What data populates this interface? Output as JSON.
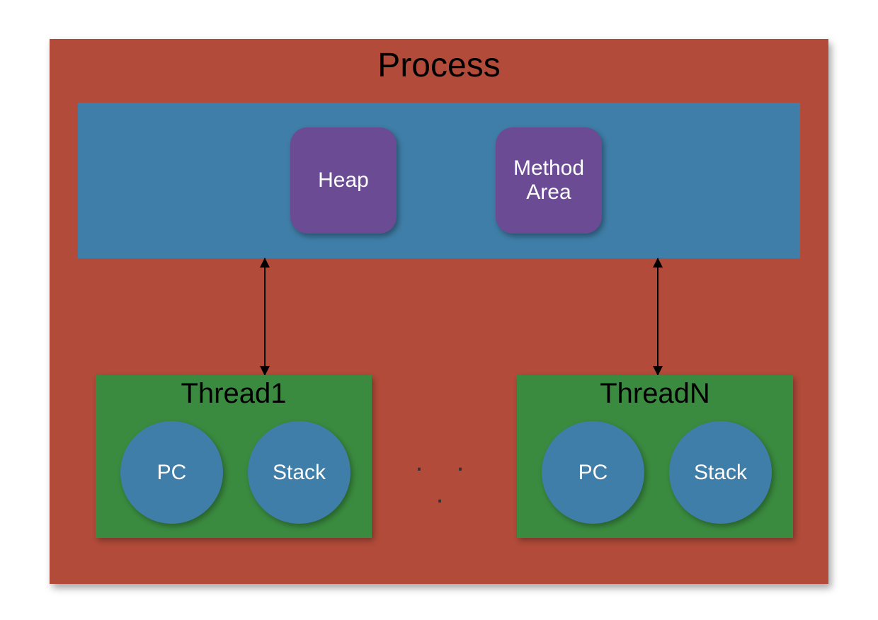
{
  "process": {
    "title": "Process",
    "shared": {
      "heap_label": "Heap",
      "method_area_label": "Method\nArea"
    },
    "threads": [
      {
        "title": "Thread1",
        "pc_label": "PC",
        "stack_label": "Stack"
      },
      {
        "title": "ThreadN",
        "pc_label": "PC",
        "stack_label": "Stack"
      }
    ],
    "ellipsis": ". . ."
  },
  "colors": {
    "process_bg": "#b24b3a",
    "shared_bg": "#3f7ea8",
    "purple": "#6b4c94",
    "thread_bg": "#3a8b3f",
    "circle_bg": "#3f7ea8"
  }
}
